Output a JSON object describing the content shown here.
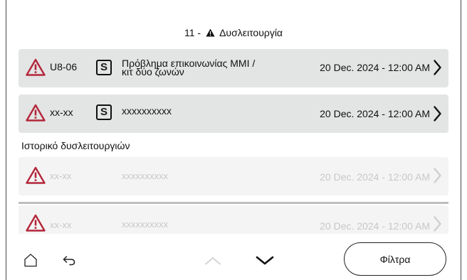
{
  "header": {
    "number": "11",
    "separator": "-",
    "label": "Δυσλειτουργία",
    "icon": "warning-icon"
  },
  "active_faults": [
    {
      "code": "U8-06",
      "badge": "S",
      "desc_line1": "Πρόβλημα επικοινωνίας MMI /",
      "desc_line2": "κιτ δύο ζωνών",
      "date": "20 Dec. 2024 - 12:00 AM"
    },
    {
      "code": "xx-xx",
      "badge": "S",
      "desc_line1": "xxxxxxxxxx",
      "desc_line2": "",
      "date": "20 Dec. 2024 - 12:00 AM"
    }
  ],
  "history": {
    "label": "Ιστορικό δυσλειτουργιών",
    "items": [
      {
        "code": "xx-xx",
        "desc": "xxxxxxxxxx",
        "date": "20 Dec. 2024 - 12:00 AM"
      },
      {
        "code": "xx-xx",
        "desc": "xxxxxxxxxx",
        "date": "20 Dec. 2024 - 12:00 AM"
      }
    ]
  },
  "footer": {
    "filter_label": "Φίλτρα",
    "icons": [
      "home-icon",
      "back-icon",
      "chevron-up-icon",
      "chevron-down-icon"
    ]
  },
  "colors": {
    "alert_red": "#b3263a",
    "row_bg": "#e3e4e4",
    "row_bg_dim": "#f4f4f4",
    "text_dim": "#c8c8c8"
  }
}
